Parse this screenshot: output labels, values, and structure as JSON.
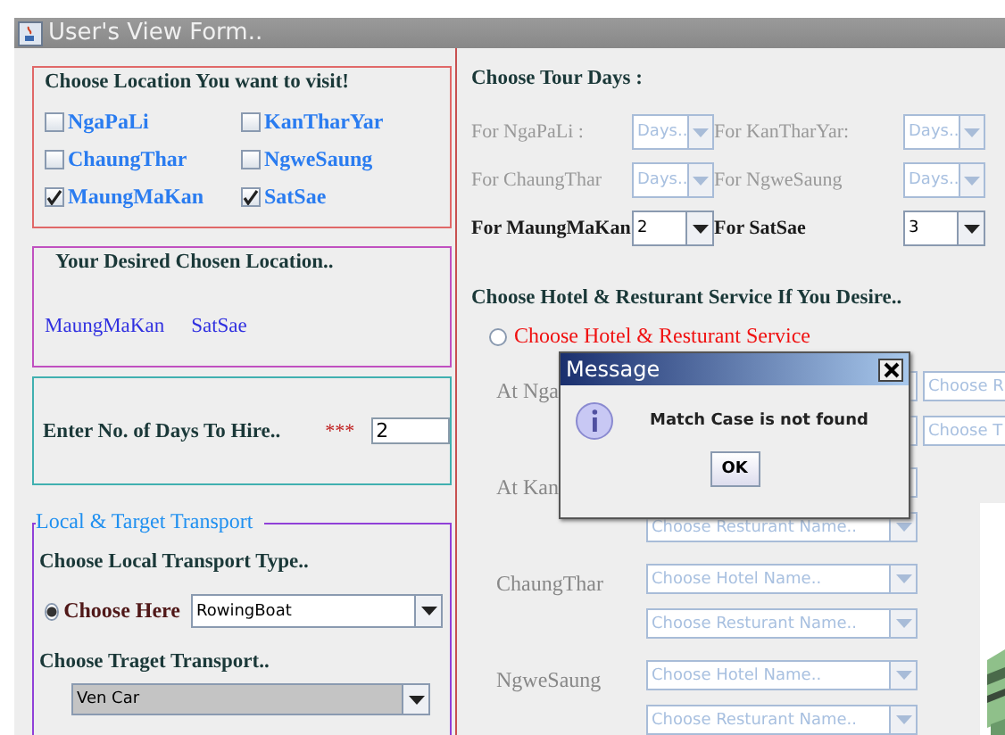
{
  "window": {
    "title": "User's View Form.."
  },
  "locations": {
    "title": "Choose Location You want to visit!",
    "options": [
      {
        "label": "NgaPaLi",
        "checked": false
      },
      {
        "label": "KanTharYar",
        "checked": false
      },
      {
        "label": "ChaungThar",
        "checked": false
      },
      {
        "label": "NgweSaung",
        "checked": false
      },
      {
        "label": "MaungMaKan",
        "checked": true
      },
      {
        "label": "SatSae",
        "checked": true
      }
    ]
  },
  "chosen": {
    "title": "Your Desired Chosen Location..",
    "items": [
      "MaungMaKan",
      "SatSae"
    ]
  },
  "days_to_hire": {
    "label": "Enter No. of Days To Hire..",
    "required_mark": "***",
    "value": "2"
  },
  "transport": {
    "title": "Local & Target Transport",
    "local_label": "Choose Local Transport Type..",
    "local_radio": {
      "label": "Choose Here",
      "selected": true
    },
    "local_value": "RowingBoat",
    "target_label": "Choose Traget Transport..",
    "target_value": "Ven Car"
  },
  "tour_days": {
    "title": "Choose Tour Days :",
    "rows": [
      {
        "label": "For NgaPaLi :",
        "value": "Days..",
        "disabled": true
      },
      {
        "label": "For KanTharYar:",
        "value": "Days..",
        "disabled": true
      },
      {
        "label": "For ChaungThar",
        "value": "Days..",
        "disabled": true
      },
      {
        "label": "For NgweSaung",
        "value": "Days..",
        "disabled": true
      },
      {
        "label": "For MaungMaKan",
        "value": "2",
        "disabled": false
      },
      {
        "label": "For SatSae",
        "value": "3",
        "disabled": false
      }
    ]
  },
  "service": {
    "title": "Choose Hotel & Resturant Service If You Desire..",
    "radio": {
      "label": "Choose Hotel & Resturant Service",
      "selected": false
    },
    "side_combos": [
      "Choose R",
      "Choose T"
    ],
    "places": [
      {
        "label": "At Nga",
        "combos": [
          {
            "disabled": true
          },
          {
            "disabled": true
          }
        ]
      },
      {
        "label": "At Kan",
        "combos": [
          {
            "disabled": true
          },
          {
            "placeholder": "Choose Resturant Name..",
            "disabled": true
          }
        ]
      },
      {
        "label": "ChaungThar",
        "combos": [
          {
            "placeholder": "Choose Hotel Name..",
            "disabled": true
          },
          {
            "placeholder": "Choose Resturant Name..",
            "disabled": true
          }
        ]
      },
      {
        "label": "NgweSaung",
        "combos": [
          {
            "placeholder": "Choose Hotel Name..",
            "disabled": true
          },
          {
            "placeholder": "Choose Resturant Name..",
            "disabled": true
          }
        ]
      }
    ]
  },
  "dialog": {
    "title": "Message",
    "message": "Match Case is not found",
    "button": "OK"
  }
}
